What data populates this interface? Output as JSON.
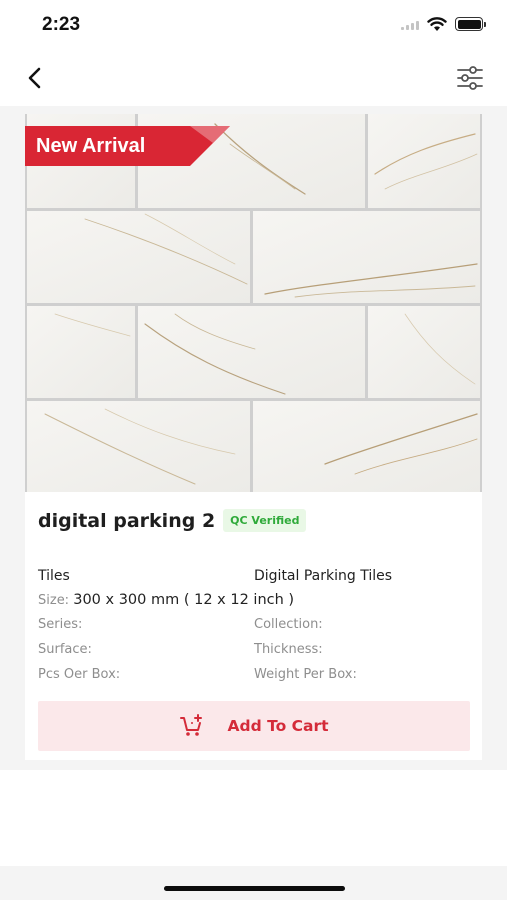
{
  "status_bar": {
    "time": "2:23",
    "icons": [
      "signal-icon",
      "wifi-icon",
      "battery-icon"
    ]
  },
  "app_bar": {
    "back_icon": "chevron-left-icon",
    "filter_icon": "sliders-icon"
  },
  "product": {
    "badge": "New Arrival",
    "title": "digital parking 2",
    "qc_badge": "QC Verified",
    "category": "Tiles",
    "collection_type": "Digital Parking Tiles",
    "size_label": "Size:",
    "size_value": "300 x 300 mm ( 12 x 12 inch )",
    "series_label": "Series:",
    "collection_label": "Collection:",
    "surface_label": "Surface:",
    "thickness_label": "Thickness:",
    "pcs_label": "Pcs Oer Box:",
    "weight_label": "Weight Per Box:"
  },
  "actions": {
    "add_to_cart": "Add To Cart",
    "cart_icon": "cart-plus-icon"
  },
  "colors": {
    "accent": "#d42b39",
    "ribbon": "#d92634",
    "cart_bg": "#fbe8ea",
    "qc_green": "#2faa3a",
    "qc_bg": "#e9f8e6"
  }
}
